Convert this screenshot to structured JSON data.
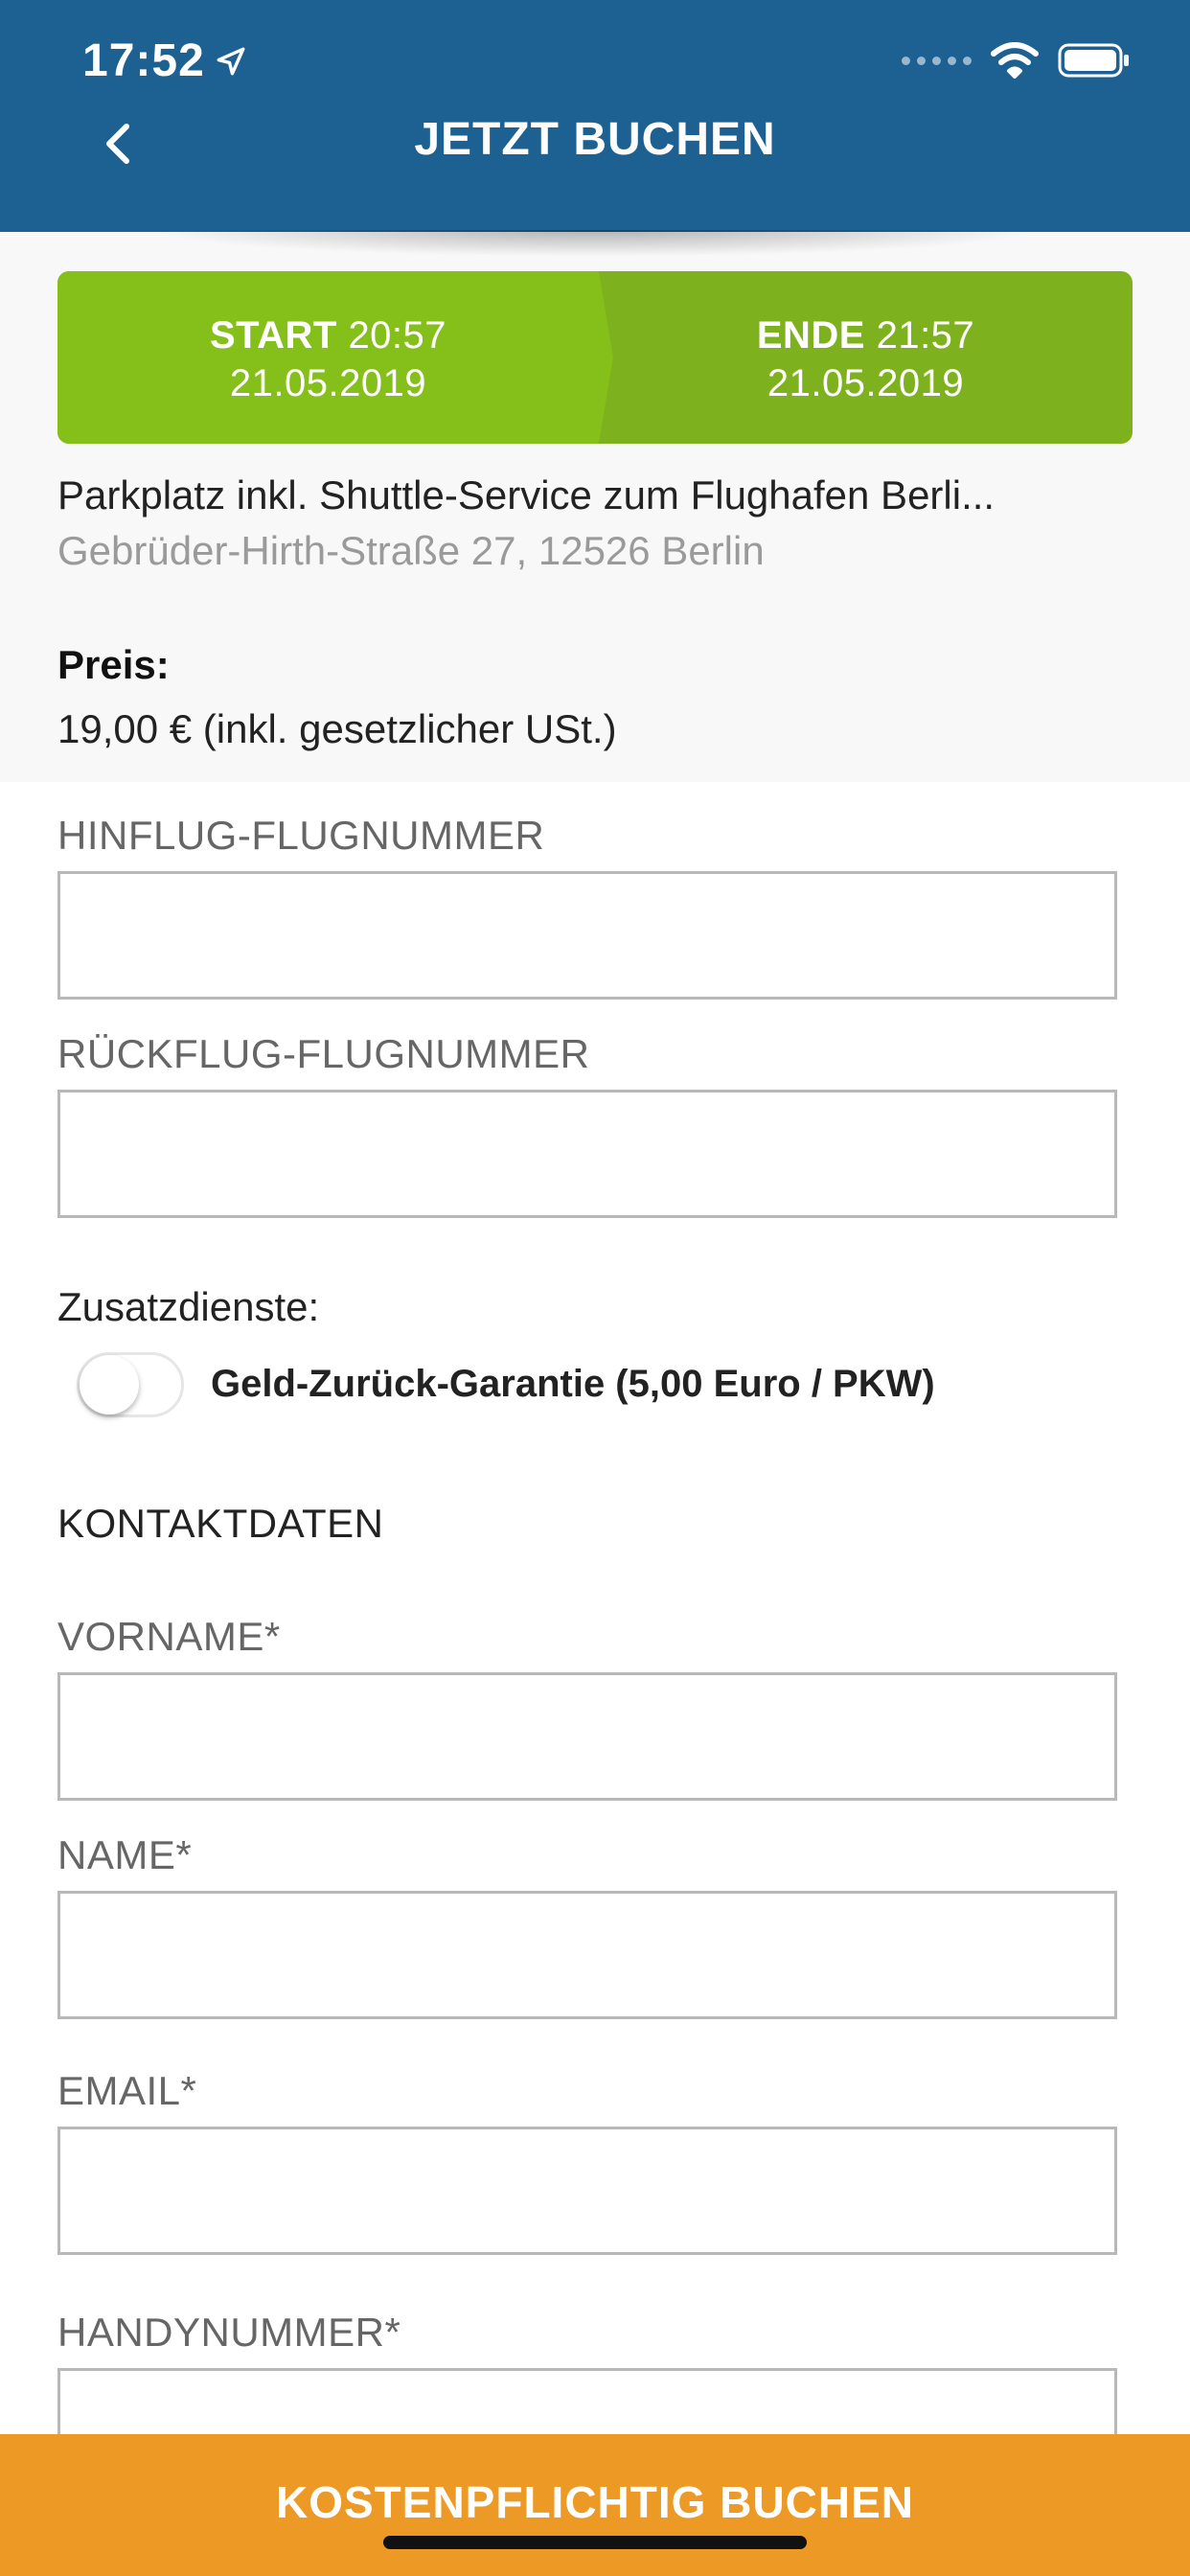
{
  "status_bar": {
    "time": "17:52"
  },
  "header": {
    "title": "JETZT BUCHEN"
  },
  "period": {
    "start_label": "START",
    "start_time": "20:57",
    "start_date": "21.05.2019",
    "end_label": "ENDE",
    "end_time": "21:57",
    "end_date": "21.05.2019"
  },
  "lot": {
    "name": "Parkplatz inkl. Shuttle-Service zum Flughafen Berli...",
    "address": "Gebrüder-Hirth-Straße 27, 12526 Berlin"
  },
  "price": {
    "label": "Preis:",
    "value": "19,00 € (inkl. gesetzlicher USt.)"
  },
  "flight": {
    "outbound_label": "HINFLUG-FLUGNUMMER",
    "outbound_value": "",
    "return_label": "RÜCKFLUG-FLUGNUMMER",
    "return_value": ""
  },
  "extras": {
    "label": "Zusatzdienste:",
    "guarantee_label": "Geld-Zurück-Garantie (5,00 Euro / PKW)",
    "guarantee_on": false
  },
  "contact": {
    "heading": "KONTAKTDATEN",
    "firstname_label": "VORNAME*",
    "firstname_value": "",
    "name_label": "NAME*",
    "name_value": "",
    "email_label": "EMAIL*",
    "email_value": "",
    "phone_label": "HANDYNUMMER*",
    "phone_value": ""
  },
  "footer": {
    "button_label": "KOSTENPFLICHTIG BUCHEN"
  },
  "colors": {
    "header": "#1d6193",
    "period_start": "#85bf1a",
    "period_end": "#7db11d",
    "footer": "#ec9a25"
  }
}
